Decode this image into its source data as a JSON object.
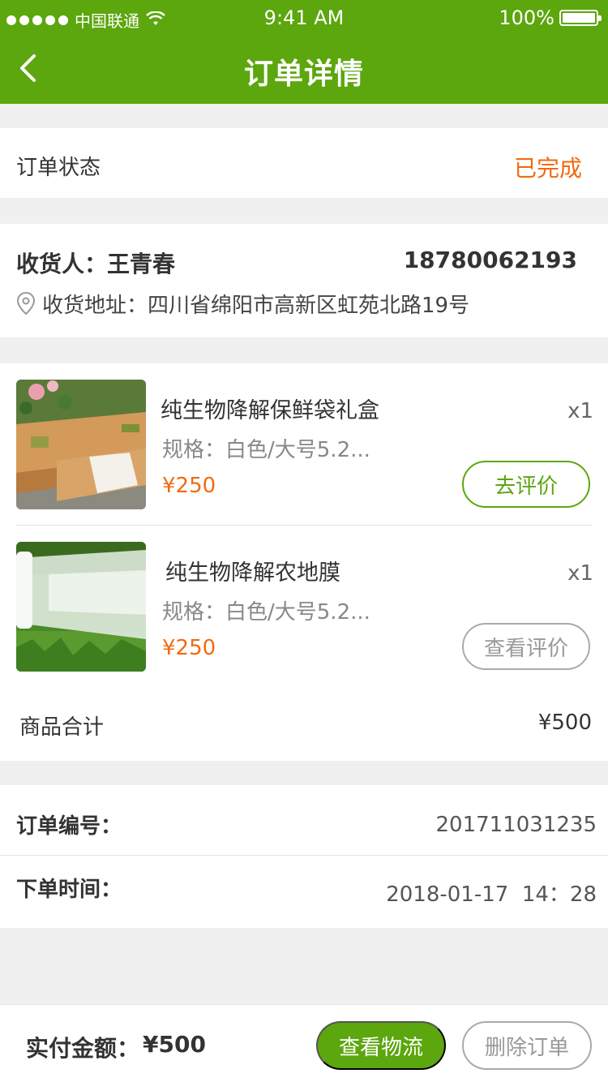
{
  "status_bar": {
    "carrier": "中国联通",
    "time": "9:41 AM",
    "battery": "100%"
  },
  "nav": {
    "title": "订单详情"
  },
  "order_status": {
    "label": "订单状态",
    "value": "已完成"
  },
  "receiver": {
    "name": "收货人：王青春",
    "phone": "18780062193",
    "address": "收货地址：四川省绵阳市高新区虹苑北路19号"
  },
  "products": [
    {
      "name": "纯生物降解保鲜袋礼盒",
      "qty": "x1",
      "spec": "规格：白色/大号5.2...",
      "price": "¥250",
      "action": "去评价"
    },
    {
      "name": "纯生物降解农地膜",
      "qty": "x1",
      "spec": "规格：白色/大号5.2...",
      "price": "¥250",
      "action": "查看评价"
    }
  ],
  "goods_total": {
    "label": "商品合计",
    "value": "¥500"
  },
  "order_info": {
    "number_label": "订单编号：",
    "number_value": "201711031235",
    "time_label": "下单时间：",
    "time_value": "2018-01-17  14：28"
  },
  "footer": {
    "paid_label": "实付金额：",
    "paid_value": "¥500",
    "logistics_button": "查看物流",
    "delete_button": "删除订单"
  },
  "colors": {
    "brand_green": "#5ca60e",
    "accent_orange": "#f26a10"
  }
}
